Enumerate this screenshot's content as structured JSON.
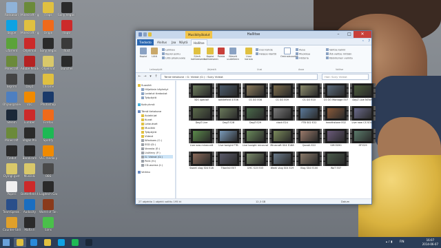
{
  "desktop": {
    "icons": [
      {
        "label": "Roskakori",
        "color": "#8fb3d9"
      },
      {
        "label": "Skype",
        "color": "#0ea2e3"
      },
      {
        "label": "uTorrent",
        "color": "#5ba33a"
      },
      {
        "label": "Minecraft",
        "color": "#6b8a3a"
      },
      {
        "label": "Skyrim",
        "color": "#444444"
      },
      {
        "label": "Ohjauspaneeli",
        "color": "#4e7fc0"
      },
      {
        "label": "Steam",
        "color": "#1b2838"
      },
      {
        "label": "Minecraft",
        "color": "#6b8a3a"
      },
      {
        "label": "Tiedot",
        "color": "#2a2a2a"
      },
      {
        "label": "Dyingl.gvst",
        "color": "#d9c86a"
      },
      {
        "label": "Paperi",
        "color": "#f0f0f0"
      },
      {
        "label": "TeamSpeak 3 Client",
        "color": "#2a4f8a"
      },
      {
        "label": "Counter-Strike GO",
        "color": "#e0a02a"
      },
      {
        "label": "Minecraft - gameplay",
        "color": "#6b8a3a"
      },
      {
        "label": "Minecraft - gameplay",
        "color": "#e0c040"
      },
      {
        "label": "Ohjelmat",
        "color": "#cc2a2a"
      },
      {
        "label": "Adobe Reader",
        "color": "#b52222"
      },
      {
        "label": "DayZ",
        "color": "#3a3a3a"
      },
      {
        "label": "VLC",
        "color": "#f08a00"
      },
      {
        "label": "Lumber",
        "color": "#cc2a2a"
      },
      {
        "label": "Vegas Pro",
        "color": "#2a2a2a"
      },
      {
        "label": "Bandicam",
        "color": "#2a2a2a"
      },
      {
        "label": "Musiikki",
        "color": "#d9c86a"
      },
      {
        "label": "Battlefield 4",
        "color": "#cc2a2a"
      },
      {
        "label": "Audacity",
        "color": "#1a6ec0"
      },
      {
        "label": "Mafia II",
        "color": "#2a2a2a"
      },
      {
        "label": "Fraps",
        "color": "#e0c040"
      },
      {
        "label": "Origin",
        "color": "#f06a1a"
      },
      {
        "label": "Sony Vegas",
        "color": "#2a2a2a"
      },
      {
        "label": "Ohjelmat",
        "color": "#d9c86a"
      },
      {
        "label": "Chrome",
        "color": "#e0c040"
      },
      {
        "label": "Photoshop",
        "color": "#1a3a6a"
      },
      {
        "label": "Firefox",
        "color": "#f06a1a"
      },
      {
        "label": "Spotify",
        "color": "#1db954"
      },
      {
        "label": "VLC media player",
        "color": "#f08a00"
      },
      {
        "label": "OBS",
        "color": "#4a4a4a"
      },
      {
        "label": "Logitech Gaming",
        "color": "#2a2a2a"
      },
      {
        "label": "World of Tanks",
        "color": "#8a3a1a"
      },
      {
        "label": "Sims",
        "color": "#4ac04a"
      },
      {
        "label": "Sony Vegas Pro",
        "color": "#2a2a2a"
      },
      {
        "label": "Raptr",
        "color": "#cc2a2a"
      },
      {
        "label": "Rust",
        "color": "#3a3a3a"
      },
      {
        "label": "launcher",
        "color": "#2a2a2a"
      }
    ]
  },
  "explorer": {
    "title": "Sony Videot",
    "context_tab": "Musiikityökalut",
    "window_title": "Hallitse",
    "tabs": [
      "Tiedosto",
      "Aloitus",
      "Jaa",
      "Näytä",
      "Hallitse"
    ],
    "ribbon": {
      "clipboard": [
        "Kopioi",
        "Liitä"
      ],
      "clipboard_small": [
        "Leikkaa",
        "Kopioi polku",
        "Liitä pikakuvake"
      ],
      "organize": [
        "Siirrä kohteeseen",
        "Kopioi kohteeseen",
        "Poista",
        "Nimeä uudelleen"
      ],
      "new": [
        "Uusi kansio"
      ],
      "new_small": [
        "Uusi kohde",
        "Helppo käyttö"
      ],
      "open": [
        "Ominaisuudet"
      ],
      "open_small": [
        "Avaa",
        "Muokkaa",
        "Historia"
      ],
      "select_small": [
        "Valitse kaikki",
        "Älä valitse mitään",
        "Käänteinen valinta"
      ],
      "groups": [
        "Leikepöytä",
        "Järjestä",
        "Uusi",
        "Avaa",
        "Valitse"
      ]
    },
    "address": "Tämä tietokone  ›  G: Videot (G:)  ›  Sony Videot",
    "search_placeholder": "Hae: Sony Videot",
    "nav": {
      "favorites": "Suosikit",
      "favorites_items": [
        "Hiljattain käytetyt",
        "Ladatut tiedostot",
        "Työpöytä"
      ],
      "homegroup": "Kotiryhmä",
      "this_pc": "Tämä tietokone",
      "pc_items": [
        "Asiakirjat",
        "Kuvat",
        "Lataukset",
        "Musiikki",
        "Työpöytä",
        "Videot",
        "Windows (C:)",
        "SSD (D:)",
        "Varasto (E:)",
        "Lisälevy (F:)",
        "G: Videot (G:)",
        "Pelit (H:)",
        "CD-asema (I:)"
      ],
      "network": "Verkko"
    },
    "files": [
      {
        "name": "3DS special!",
        "tint": "#6a7a5a"
      },
      {
        "name": "battlefield 4 E06",
        "tint": "#4a5a6a"
      },
      {
        "name": "CS GO E08",
        "tint": "#8a7a5a"
      },
      {
        "name": "CS GO E09",
        "tint": "#7a6a4a"
      },
      {
        "name": "CS GO E10",
        "tint": "#8a8a6a"
      },
      {
        "name": "CS GO Montage E07",
        "tint": "#5a6a7a"
      },
      {
        "name": "DayZ Live NOW!!",
        "tint": "#4a5a3a"
      },
      {
        "name": "DayZ Live",
        "tint": "#5a6a4a"
      },
      {
        "name": "DayZ E28",
        "tint": "#6a7a5a"
      },
      {
        "name": "DayZ E29",
        "tint": "#4a6a4a"
      },
      {
        "name": "clock E24",
        "tint": "#7a7a7a"
      },
      {
        "name": "FTB S02 E22",
        "tint": "#5a7a9a"
      },
      {
        "name": "hearthstone E02",
        "tint": "#8a5a3a"
      },
      {
        "name": "Live now CS SOLO",
        "tint": "#6a6a8a"
      },
      {
        "name": "Live now minecraft",
        "tint": "#5a8a4a"
      },
      {
        "name": "Live tonight FTB",
        "tint": "#7a9aba"
      },
      {
        "name": "Live tonight minecraft",
        "tint": "#6a8a5a"
      },
      {
        "name": "Minecraft S04 E188",
        "tint": "#7a8a5a"
      },
      {
        "name": "QandA E22",
        "tint": "#9a7a6a"
      },
      {
        "name": "SIM E090",
        "tint": "#6a5a7a"
      },
      {
        "name": "SP E29",
        "tint": "#5a7a6a"
      },
      {
        "name": "Sweet vlog S04 E28",
        "tint": "#8a6a5a"
      },
      {
        "name": "Titanfall E07",
        "tint": "#5a5a6a"
      },
      {
        "name": "UHC S15 E03",
        "tint": "#7a8a6a"
      },
      {
        "name": "Week vlog S04 E29",
        "tint": "#6a7a8a"
      },
      {
        "name": "Vlog S04 E100",
        "tint": "#8a7a6a"
      },
      {
        "name": "WoT E07",
        "tint": "#4a5a4a"
      }
    ],
    "status_left": "27 objektia   1 objekti valittu  195 kt",
    "status_mid": "12,3 GB",
    "status_right": "Datum"
  },
  "taskbar": {
    "apps": [
      {
        "name": "windows-explorer",
        "color": "#e0c040"
      },
      {
        "name": "store",
        "color": "#2a8ad9"
      },
      {
        "name": "chrome",
        "color": "#e0c040"
      },
      {
        "name": "skype",
        "color": "#0ea2e3"
      },
      {
        "name": "spotify",
        "color": "#1db954"
      },
      {
        "name": "steam",
        "color": "#1b2838"
      }
    ],
    "tray_lang": "FIN",
    "clock_time": "16:07",
    "clock_date": "2014-06-07"
  }
}
